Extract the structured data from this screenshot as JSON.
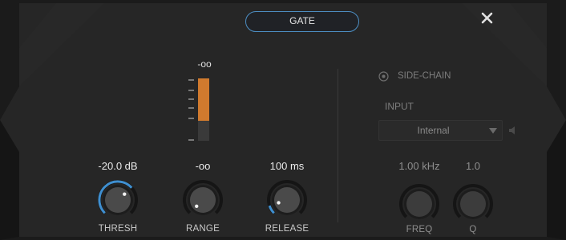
{
  "mode_button": {
    "label": "GATE"
  },
  "meter": {
    "value_label": "-oo",
    "level_fraction": 0.68
  },
  "knobs": [
    {
      "id": "thresh",
      "label": "THRESH",
      "value": "-20.0 dB",
      "position": 0.68
    },
    {
      "id": "range",
      "label": "RANGE",
      "value": "-oo",
      "position": 0.0
    },
    {
      "id": "release",
      "label": "RELEASE",
      "value": "100 ms",
      "position": 0.1
    }
  ],
  "side_chain": {
    "label": "SIDE-CHAIN",
    "enabled": false,
    "input_label": "INPUT",
    "input_selected": "Internal",
    "freq": {
      "label": "FREQ",
      "value": "1.00 kHz"
    },
    "q": {
      "label": "Q",
      "value": "1.0"
    }
  },
  "icons": {
    "close": "close-icon",
    "dropdown_arrow": "chevron-down-icon",
    "speaker": "speaker-icon",
    "radio": "radio-icon"
  },
  "colors": {
    "accent": "#3f8fd0",
    "meter": "#d07a2e",
    "panel": "#262626",
    "background": "#1c1c1c"
  }
}
